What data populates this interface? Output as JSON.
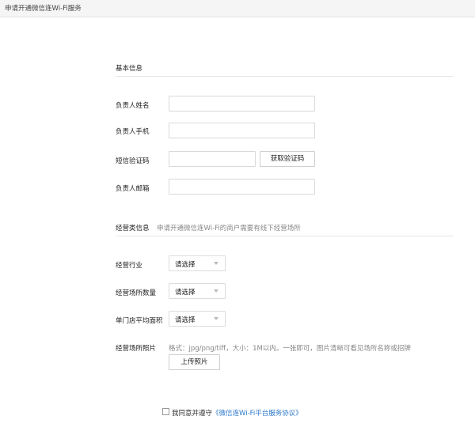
{
  "page": {
    "title": "申请开通微信连Wi-Fi服务"
  },
  "basic": {
    "section_title": "基本信息",
    "name_label": "负责人姓名",
    "phone_label": "负责人手机",
    "sms_label": "短信验证码",
    "sms_button": "获取验证码",
    "email_label": "负责人邮箱"
  },
  "business": {
    "section_title": "经营类信息",
    "hint": "申请开通微信连Wi-Fi的商户需要有线下经营场所",
    "industry_label": "经营行业",
    "industry_value": "请选择",
    "store_count_label": "经营场所数量",
    "store_count_value": "请选择",
    "avg_area_label": "单门店平均面积",
    "avg_area_value": "请选择",
    "photo_label": "经营场所照片",
    "photo_note": "格式：jpg/png/tiff，大小：1M以内。一张即可，图片清晰可看见场所名称或招牌",
    "upload_button": "上传照片"
  },
  "agreement": {
    "prefix": "我同意并遵守",
    "link": "《微信连Wi-Fi平台服务协议》"
  }
}
